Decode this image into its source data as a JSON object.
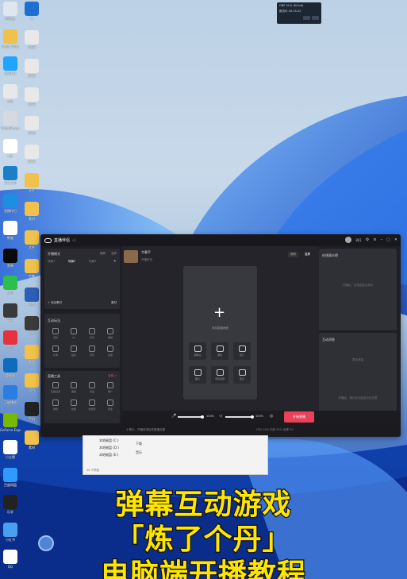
{
  "toast": {
    "title": "OBS 30.0 (64-bit)",
    "line2": "推流中 00:15:22"
  },
  "desktop_left": [
    {
      "label": "回收站",
      "color": "#dfe6ee"
    },
    {
      "label": "bash_Data",
      "color": "#f0c14b"
    },
    {
      "label": "腾讯QQ",
      "color": "#1fa4ff"
    },
    {
      "label": "gitt",
      "color": "#e8e8e8"
    },
    {
      "label": "VideoPlayer",
      "color": "#d5d9e0"
    },
    {
      "label": "dot",
      "color": "#ffffff"
    },
    {
      "label": "STC-ISP",
      "color": "#1a7fc6"
    },
    {
      "label": "直播伴侣",
      "color": "#1d8fe0"
    },
    {
      "label": "熊猫",
      "color": "#ffffff"
    },
    {
      "label": "剪映",
      "color": "#0a0a0a"
    },
    {
      "label": "微信",
      "color": "#2bbf4b"
    },
    {
      "label": "千牛",
      "color": "#3a3a3a"
    },
    {
      "label": "金山",
      "color": "#e4333c"
    },
    {
      "label": "管理器",
      "color": "#0f6cbd"
    },
    {
      "label": "万能播放",
      "color": "#2a7de1"
    },
    {
      "label": "GeForce Experience",
      "color": "#76b900"
    },
    {
      "label": "小企鹅",
      "color": "#ffffff"
    },
    {
      "label": "百度网盘",
      "color": "#2e9bff"
    },
    {
      "label": "乐学",
      "color": "#222"
    },
    {
      "label": "小红书",
      "color": "#4b9ff0"
    },
    {
      "label": "QQ",
      "color": "#ffffff"
    }
  ],
  "desktop_right": [
    {
      "label": "K",
      "color": "#1f6fd1"
    },
    {
      "label": "2023",
      "color": "#e8e8e8"
    },
    {
      "label": "2023",
      "color": "#e8e8e8"
    },
    {
      "label": "2023",
      "color": "#e8e8e8"
    },
    {
      "label": "2023",
      "color": "#e8e8e8"
    },
    {
      "label": "2023",
      "color": "#e8e8e8"
    },
    {
      "label": "文件",
      "color": "#f0c14b"
    },
    {
      "label": "素材",
      "color": "#f0c14b"
    },
    {
      "label": "文件",
      "color": "#f0c14b"
    },
    {
      "label": "合集",
      "color": "#f0c14b"
    },
    {
      "label": "视频",
      "color": "#2c5fb5"
    },
    {
      "label": "软件",
      "color": "#3b3b3b"
    },
    {
      "label": "截图",
      "color": "#f0c14b"
    },
    {
      "label": "项目",
      "color": "#f0c14b"
    },
    {
      "label": "手机",
      "color": "#222"
    },
    {
      "label": "素材",
      "color": "#f0c14b"
    }
  ],
  "app": {
    "title": "直播伴侣",
    "version": "v5",
    "user_count": "861",
    "left": {
      "scene_title": "开播模式",
      "scene_tab_a": "横屏",
      "scene_tab_b": "竖屏",
      "scene_tabs": [
        "场景1",
        "场景2",
        "场景3"
      ],
      "add_material": "+ 添加素材",
      "material_btn": "素材",
      "interact_title": "互动玩法",
      "interact_items": [
        "连线",
        "PK",
        "红包",
        "福袋",
        "礼物",
        "抽奖",
        "音乐",
        "投票"
      ],
      "tools_title": "直播工具",
      "tools_more": "全部 >",
      "tools_items": [
        "直播设置",
        "美颜",
        "商品",
        "推广",
        "弹幕",
        "数据",
        "快捷键",
        "更多"
      ]
    },
    "profile": {
      "name": "字幕手",
      "sub": "开播时长"
    },
    "stage": {
      "landscape": "横屏",
      "portrait": "竖屏",
      "hint": "添加直播画面",
      "sources": [
        {
          "label": "摄像头"
        },
        {
          "label": "游戏"
        },
        {
          "label": "窗口"
        },
        {
          "label": "图片"
        },
        {
          "label": "手机投屏"
        },
        {
          "label": "更多"
        }
      ]
    },
    "right": {
      "rank_title": "在线观众榜",
      "rank_hint": "开播后，这里会显示观众",
      "chat_title": "互动消息",
      "chat_hint": "暂无消息",
      "chat_hint2": "开播后，观众互动会显示在这里",
      "input_placeholder": "说点什么"
    },
    "bottom": {
      "mic_pct": "100%",
      "spk_pct": "100%",
      "start_label": "开始直播",
      "status_left": "小提示：开播前请检查直播设置",
      "status_right": "CPU 10%    内存 55%    帧率 30"
    }
  },
  "explorer": {
    "rows": [
      "本地磁盘 (C:)",
      "本地磁盘 (D:)",
      "本地磁盘 (E:)",
      "下载",
      "音乐"
    ],
    "footer": "10 个项目"
  },
  "caption": {
    "line1": "弹幕互动游戏",
    "line2": "「炼了个丹」",
    "line3": "电脑端开播教程"
  }
}
